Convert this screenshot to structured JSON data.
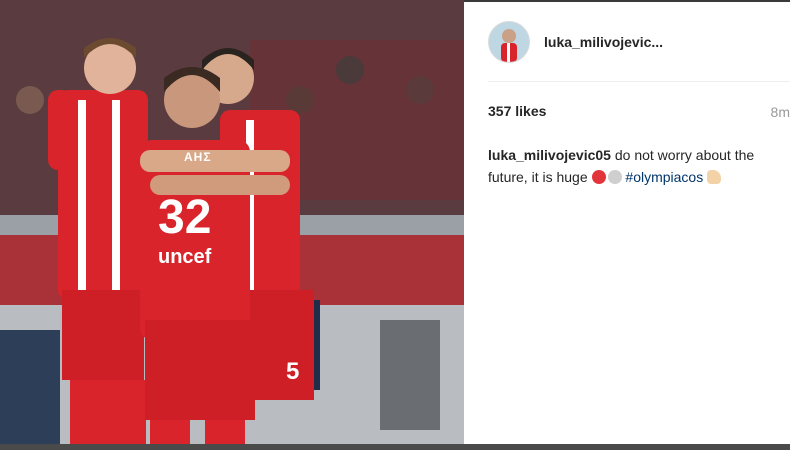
{
  "post": {
    "username_short": "luka_milivojevic...",
    "likes": "357 likes",
    "time": "8m",
    "caption_user": "luka_milivojevic05",
    "caption_text": " do not worry about the future, it is huge ",
    "hashtag": "#olympiacos"
  },
  "photo": {
    "jersey_number_front": "32",
    "jersey_number_back": "5",
    "sponsor": "uncef",
    "name_on_shirt": "ΑΗΣ"
  },
  "emoji": [
    "red-circle-icon",
    "white-circle-icon",
    "flexed-biceps-icon"
  ],
  "colors": {
    "kit_red": "#d8242a",
    "hashtag": "#003569",
    "text": "#262626"
  }
}
